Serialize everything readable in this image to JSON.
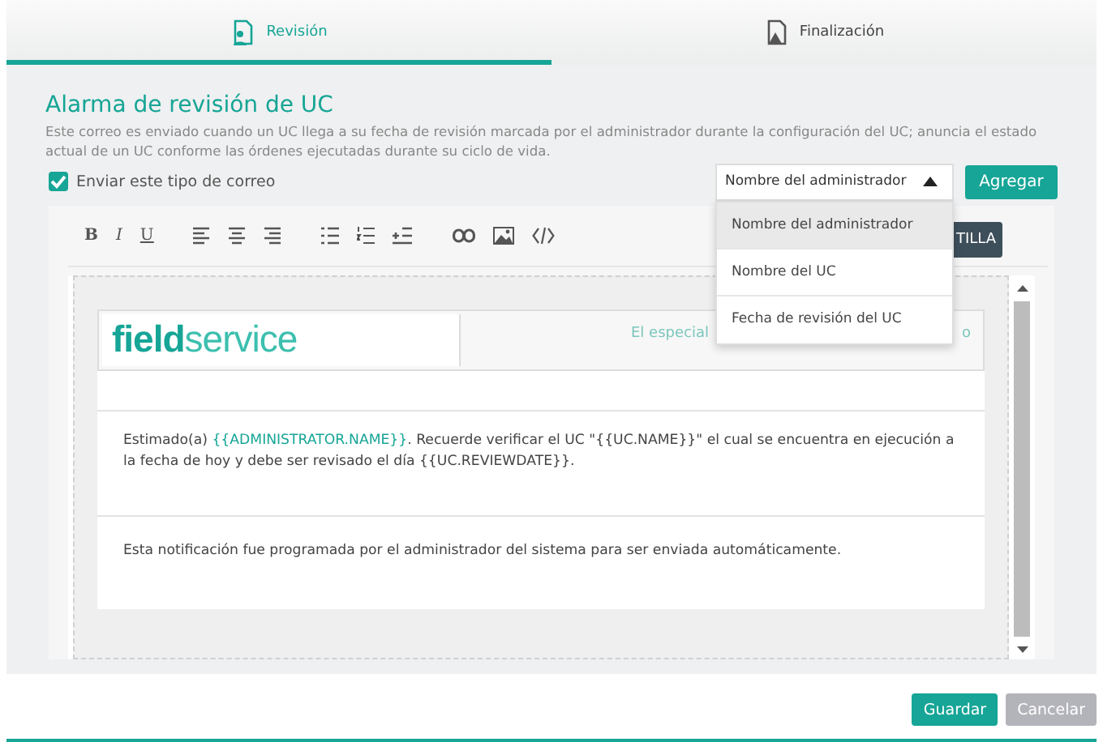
{
  "tabs": [
    {
      "label": "Revisión",
      "selected": true
    },
    {
      "label": "Finalización",
      "selected": false
    }
  ],
  "title": "Alarma de revisión de UC",
  "description": "Este correo es enviado cuando un UC llega a su fecha de revisión marcada por el administrador durante la configuración del UC; anuncia el estado actual de un UC conforme las órdenes ejecutadas durante su ciclo de vida.",
  "send_checkbox": {
    "label": "Enviar este tipo de correo",
    "checked": true
  },
  "variable_select": {
    "value": "Nombre del administrador",
    "expanded": true,
    "options": [
      {
        "label": "Nombre del administrador",
        "selected": true
      },
      {
        "label": "Nombre del UC",
        "selected": false
      },
      {
        "label": "Fecha de revisión del UC",
        "selected": false
      }
    ]
  },
  "add_button": "Agregar",
  "toolbar": [
    {
      "kind": "bold",
      "text": "B"
    },
    {
      "kind": "italic",
      "text": "I"
    },
    {
      "kind": "underline",
      "text": "U"
    },
    {
      "kind": "sep"
    },
    {
      "kind": "align-left"
    },
    {
      "kind": "align-center"
    },
    {
      "kind": "align-right"
    },
    {
      "kind": "sep"
    },
    {
      "kind": "bullets"
    },
    {
      "kind": "numbers"
    },
    {
      "kind": "indent"
    },
    {
      "kind": "sep"
    },
    {
      "kind": "link"
    },
    {
      "kind": "image"
    },
    {
      "kind": "code"
    }
  ],
  "template_button": "TILLA",
  "email": {
    "logo_bold": "field",
    "logo_light": "service",
    "tagline_start": "El especial",
    "tagline_end": "o",
    "body": "Estimado(a) {{ADMINISTRATOR.NAME}}. Recuerde verificar el UC \"{{UC.NAME}}\" el cual se encuentra en ejecución a la fecha de hoy y debe ser revisado el día {{UC.REVIEWDATE}}.",
    "footer": "Esta notificación fue programada por el administrador del sistema para ser enviada automáticamente."
  },
  "buttons": [
    {
      "label": "Guardar",
      "kind": "primary"
    },
    {
      "label": "Cancelar",
      "kind": "secondary"
    }
  ]
}
